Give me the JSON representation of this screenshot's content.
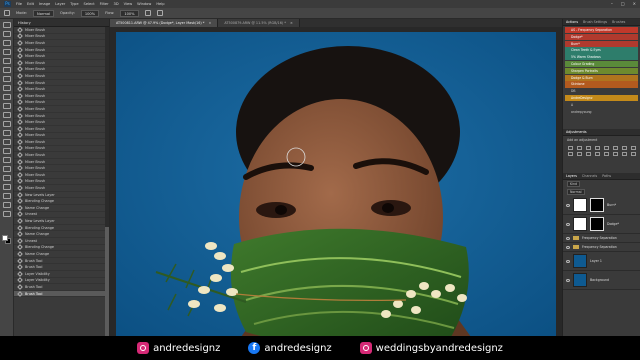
{
  "menubar": {
    "app_icon": "Ps",
    "items": [
      "File",
      "Edit",
      "Image",
      "Layer",
      "Type",
      "Select",
      "Filter",
      "3D",
      "View",
      "Window",
      "Help"
    ]
  },
  "options": {
    "mode_label": "Mode:",
    "mode_value": "Normal",
    "opacity_label": "Opacity:",
    "opacity_value": "100%",
    "flow_label": "Flow:",
    "flow_value": "100%"
  },
  "history": {
    "title": "History",
    "items": [
      "Mixer Brush",
      "Mixer Brush",
      "Mixer Brush",
      "Mixer Brush",
      "Mixer Brush",
      "Mixer Brush",
      "Mixer Brush",
      "Mixer Brush",
      "Mixer Brush",
      "Mixer Brush",
      "Mixer Brush",
      "Mixer Brush",
      "Mixer Brush",
      "Mixer Brush",
      "Mixer Brush",
      "Mixer Brush",
      "Mixer Brush",
      "Mixer Brush",
      "Mixer Brush",
      "Mixer Brush",
      "Mixer Brush",
      "Mixer Brush",
      "Mixer Brush",
      "Mixer Brush",
      "Mixer Brush",
      "New Levels Layer",
      "Blending Change",
      "Name Change",
      "Unnest",
      "New Levels Layer",
      "Blending Change",
      "Name Change",
      "Unnest",
      "Blending Change",
      "Name Change",
      "Brush Tool",
      "Brush Tool",
      "Layer Visibility",
      "Layer Visibility",
      "Brush Tool",
      "Brush Tool"
    ]
  },
  "document": {
    "tabs": [
      {
        "label": "AT500811.ARW @ 47.9% (Dodge*, Layer Mask/16) *",
        "active": true
      },
      {
        "label": "AT500879.ARW @ 11.5% (RGB/16) *",
        "active": false
      }
    ],
    "status": "47.85%"
  },
  "right_panel": {
    "tabs": [
      "Actions",
      "Brush Settings",
      "Brushes"
    ],
    "actions": [
      {
        "label": "AS - Frequency Separation",
        "color": "#c0392b"
      },
      {
        "label": "Dodge*",
        "color": "#b03a2e"
      },
      {
        "label": "Burn*",
        "color": "#b03a2e"
      },
      {
        "label": "Clean Teeth & Eyes",
        "color": "#2e7d6b"
      },
      {
        "label": "5% Warm Shadows",
        "color": "#2e7d6b"
      },
      {
        "label": "Colour Grading",
        "color": "#5a8a3a"
      },
      {
        "label": "Sharpen Portraits",
        "color": "#6e8a2e"
      },
      {
        "label": "Dodge & Burn",
        "color": "#b0741e"
      },
      {
        "label": "Skintone",
        "color": "#b35a1e"
      },
      {
        "label": "DB",
        "color": ""
      },
      {
        "label": "AndreDesignz",
        "color": "#c48a1a"
      },
      {
        "label": "A",
        "color": ""
      },
      {
        "label": "andrepyoung",
        "color": ""
      }
    ],
    "adjustments_title": "Adjustments",
    "adjustments_hint": "Add an adjustment",
    "layer_tabs": [
      "Layers",
      "Channels",
      "Paths"
    ],
    "kind_label": "Kind",
    "blend_value": "Normal",
    "layers": [
      {
        "name": "Burn*",
        "type": "mask"
      },
      {
        "name": "Dodge*",
        "type": "mask"
      },
      {
        "name": "Frequency Separation",
        "type": "folder"
      },
      {
        "name": "Frequency Separation",
        "type": "folder"
      },
      {
        "name": "Layer 1",
        "type": "photo"
      },
      {
        "name": "Background",
        "type": "photo"
      }
    ]
  },
  "banner": {
    "items": [
      {
        "icon": "instagram-icon",
        "text": "andredesignz"
      },
      {
        "icon": "facebook-icon",
        "text": "andredesignz"
      },
      {
        "icon": "instagram-icon",
        "text": "weddingsbyandredesignz"
      }
    ]
  }
}
